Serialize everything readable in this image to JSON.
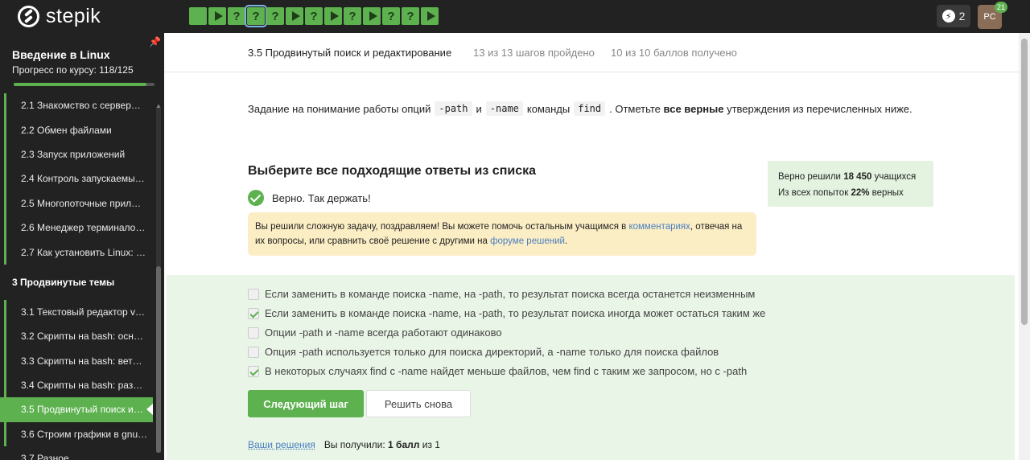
{
  "brand": {
    "name": "stepik"
  },
  "steps": [
    {
      "type": "solved",
      "icon": ""
    },
    {
      "type": "play",
      "icon": "play-icon"
    },
    {
      "type": "question",
      "icon": "?"
    },
    {
      "type": "question",
      "icon": "?",
      "current": true
    },
    {
      "type": "question",
      "icon": "?"
    },
    {
      "type": "play",
      "icon": "play-icon"
    },
    {
      "type": "question",
      "icon": "?"
    },
    {
      "type": "play",
      "icon": "play-icon"
    },
    {
      "type": "question",
      "icon": "?"
    },
    {
      "type": "play",
      "icon": "play-icon"
    },
    {
      "type": "question",
      "icon": "?"
    },
    {
      "type": "question",
      "icon": "?"
    },
    {
      "type": "play",
      "icon": "play-icon"
    }
  ],
  "user": {
    "energy": "2",
    "initials": "PC",
    "notifications": "21"
  },
  "sidebar": {
    "course_title": "Введение в Linux",
    "progress_text": "Прогресс по курсу:  118/125",
    "progress_fraction": 0.944,
    "items": [
      {
        "label": "2.1  Знакомство с сервер…",
        "kind": "lesson",
        "done": true
      },
      {
        "label": "2.2  Обмен файлами",
        "kind": "lesson",
        "done": true
      },
      {
        "label": "2.3  Запуск приложений",
        "kind": "lesson",
        "done": true
      },
      {
        "label": "2.4  Контроль запускаемы…",
        "kind": "lesson",
        "done": true
      },
      {
        "label": "2.5  Многопоточные прил…",
        "kind": "lesson",
        "done": true
      },
      {
        "label": "2.6  Менеджер терминало…",
        "kind": "lesson",
        "done": true
      },
      {
        "label": "2.7  Как установить Linux: …",
        "kind": "lesson",
        "done": true
      },
      {
        "label": "3  Продвинутые темы",
        "kind": "section",
        "done": false
      },
      {
        "label": "3.1  Текстовый редактор v…",
        "kind": "lesson",
        "done": true
      },
      {
        "label": "3.2  Скрипты на bash: осн…",
        "kind": "lesson",
        "done": true
      },
      {
        "label": "3.3  Скрипты на bash: вет…",
        "kind": "lesson",
        "done": true
      },
      {
        "label": "3.4  Скрипты на bash: раз…",
        "kind": "lesson",
        "done": true
      },
      {
        "label": "3.5  Продвинутый поиск и…",
        "kind": "lesson",
        "done": true,
        "active": true
      },
      {
        "label": "3.6  Строим графики в gnu…",
        "kind": "lesson",
        "done": true
      },
      {
        "label": "3.7  Разное",
        "kind": "lesson",
        "done": false
      }
    ]
  },
  "header": {
    "step_title": "3.5 Продвинутый поиск и редактирование",
    "steps_done": "13 из 13 шагов пройдено",
    "points": "10 из 10 баллов  получено"
  },
  "task": {
    "part1": "Задание на понимание работы опций",
    "code1": "-path",
    "part2": "и",
    "code2": "-name",
    "part3": "команды",
    "code3": "find",
    "part4": ". Отметьте",
    "bold": "все верные",
    "part5": "утверждения из перечисленных ниже."
  },
  "quiz": {
    "title": "Выберите все подходящие ответы из списка",
    "status": "Верно. Так держать!",
    "congrats_1": "Вы решили сложную задачу, поздравляем! Вы можете помочь остальным учащимся в",
    "congrats_link1": "комментариях",
    "congrats_2": ", отвечая на их вопросы, или сравнить своё решение с другими на",
    "congrats_link2": "форуме решений",
    "congrats_3": ".",
    "answers": [
      {
        "text": "Если заменить в команде поиска -name, на -path, то результат поиска всегда останется неизменным",
        "checked": false
      },
      {
        "text": "Если заменить в команде поиска -name, на -path, то результат поиска иногда может остаться таким же",
        "checked": true
      },
      {
        "text": "Опции -path и -name всегда работают одинаково",
        "checked": false
      },
      {
        "text": "Опция -path используется только для поиска директорий, а -name только для поиска файлов",
        "checked": false
      },
      {
        "text": "В некоторых случаях find с -name найдет меньше файлов, чем find с таким же запросом, но с -path",
        "checked": true
      }
    ],
    "next_label": "Следующий шаг",
    "retry_label": "Решить снова",
    "your_solutions": "Ваши решения",
    "score_prefix": "Вы получили:",
    "score_bold": "1 балл",
    "score_suffix": "из 1"
  },
  "stats": {
    "solved_prefix": "Верно решили",
    "solved_count": "18 450",
    "solved_suffix": "учащихся",
    "attempts_prefix": "Из всех попыток",
    "attempts_percent": "22%",
    "attempts_suffix": "верных"
  },
  "colors": {
    "accent": "#5db14f",
    "topbar": "#222222",
    "notice": "#fbedc4",
    "stats_bg": "#e3f3e0",
    "answers_bg": "#e9f5e6",
    "link": "#4a7fc1"
  }
}
